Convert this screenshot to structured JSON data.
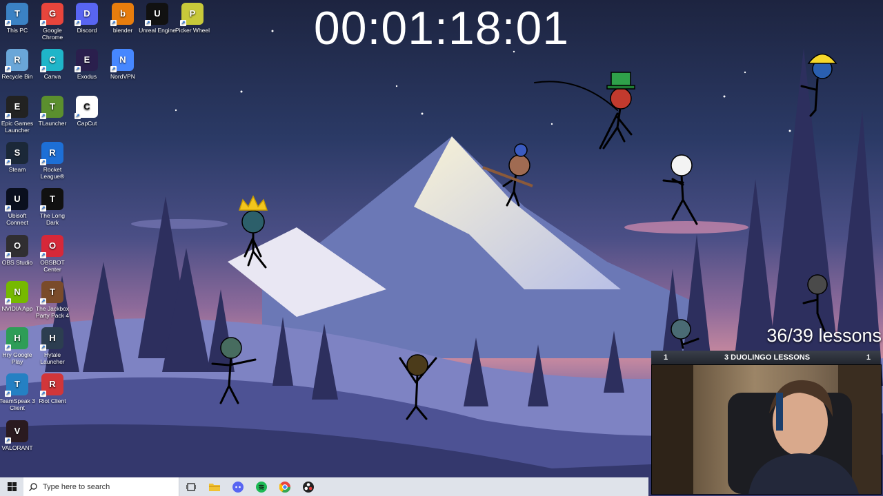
{
  "desktop": {
    "icons": [
      {
        "label": "This PC",
        "icon": "computer-icon",
        "color": "#3b82c4"
      },
      {
        "label": "Google Chrome",
        "icon": "chrome-icon",
        "color": "#e8453c"
      },
      {
        "label": "Discord",
        "icon": "discord-icon",
        "color": "#5865f2"
      },
      {
        "label": "blender",
        "icon": "blender-icon",
        "color": "#e87d0d"
      },
      {
        "label": "Unreal Engine",
        "icon": "unreal-icon",
        "color": "#111111"
      },
      {
        "label": "Picker Wheel",
        "icon": "wheel-icon",
        "color": "#c8c93a"
      },
      {
        "label": "Recycle Bin",
        "icon": "recycle-bin-icon",
        "color": "#6aa6d8"
      },
      {
        "label": "Canva",
        "icon": "canva-icon",
        "color": "#1fb5c9"
      },
      {
        "label": "Exodus",
        "icon": "exodus-icon",
        "color": "#2a1f4d"
      },
      {
        "label": "NordVPN",
        "icon": "nordvpn-icon",
        "color": "#4687ff"
      },
      {
        "label": "Epic Games Launcher",
        "icon": "epic-games-icon",
        "color": "#222222"
      },
      {
        "label": "TLauncher",
        "icon": "minecraft-icon",
        "color": "#5b8f2e"
      },
      {
        "label": "CapCut",
        "icon": "capcut-icon",
        "color": "#ffffff"
      },
      {
        "label": "Steam",
        "icon": "steam-icon",
        "color": "#1b2838"
      },
      {
        "label": "Rocket League®",
        "icon": "rocket-league-icon",
        "color": "#1d6fd6"
      },
      {
        "label": "Ubisoft Connect",
        "icon": "ubisoft-icon",
        "color": "#0a0f1e"
      },
      {
        "label": "The Long Dark",
        "icon": "the-long-dark-icon",
        "color": "#111111"
      },
      {
        "label": "OBS Studio",
        "icon": "obs-icon",
        "color": "#302e31"
      },
      {
        "label": "OBSBOT Center",
        "icon": "obsbot-icon",
        "color": "#d62839"
      },
      {
        "label": "NVIDIA App",
        "icon": "nvidia-icon",
        "color": "#76b900"
      },
      {
        "label": "The Jackbox Party Pack 4",
        "icon": "jackbox-icon",
        "color": "#7a4b2a"
      },
      {
        "label": "Hry Google Play",
        "icon": "google-play-games-icon",
        "color": "#2e9d57"
      },
      {
        "label": "Hytale Launcher",
        "icon": "hytale-icon",
        "color": "#2c3e50"
      },
      {
        "label": "TeamSpeak 3 Client",
        "icon": "teamspeak-icon",
        "color": "#2580c3"
      },
      {
        "label": "Riot Client",
        "icon": "riot-icon",
        "color": "#d13639"
      },
      {
        "label": "VALORANT",
        "icon": "valorant-icon",
        "color": "#2a1a1f"
      }
    ]
  },
  "overlay": {
    "timer": "00:01:18:01",
    "lessons_progress": "36/39 lessons",
    "webcam_bar": {
      "left": "1",
      "title": "3 DUOLINGO LESSONS",
      "right": "1"
    }
  },
  "taskbar": {
    "start_icon": "windows-start-icon",
    "search_placeholder": "Type here to search",
    "pinned": [
      "task-view-icon",
      "file-explorer-icon",
      "discord-icon",
      "spotify-icon",
      "chrome-icon",
      "obs-icon"
    ]
  }
}
